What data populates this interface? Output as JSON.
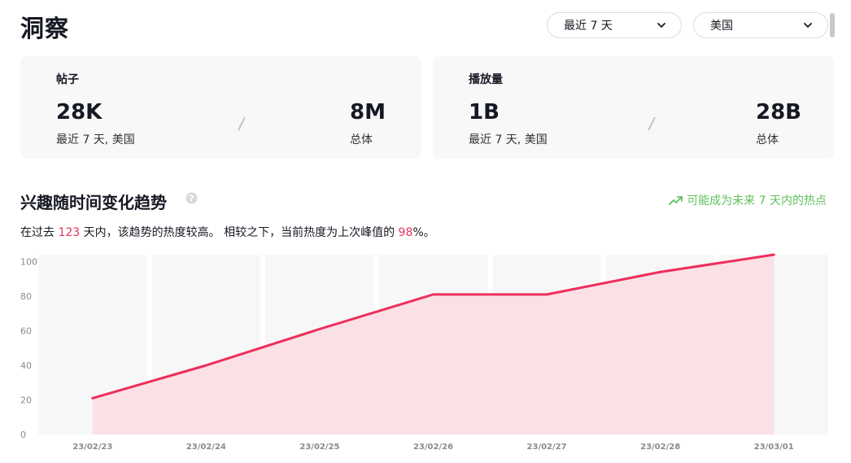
{
  "header": {
    "title": "洞察"
  },
  "filters": {
    "period": {
      "selected": "最近 7 天"
    },
    "region": {
      "selected": "美国"
    }
  },
  "cards": [
    {
      "title": "帖子",
      "recent_value": "28K",
      "recent_label": "最近 7 天, 美国",
      "total_value": "8M",
      "total_label": "总体"
    },
    {
      "title": "播放量",
      "recent_value": "1B",
      "recent_label": "最近 7 天, 美国",
      "total_value": "28B",
      "total_label": "总体"
    }
  ],
  "trend": {
    "title": "兴趣随时间变化趋势",
    "hint": "可能成为未来 7 天内的热点",
    "desc_prefix": "在过去 ",
    "days": "123",
    "desc_middle": " 天内，该趋势的热度较高。 相较之下，当前热度为上次峰值的 ",
    "peak_percent": "98",
    "desc_suffix": "%。"
  },
  "colors": {
    "accent": "#ee2e5c",
    "area_fill": "#fbe1e6",
    "hint_green": "#5fbf5b",
    "band": "#f7f7f7"
  },
  "chart_data": {
    "type": "area",
    "x": [
      "23/02/23",
      "23/02/24",
      "23/02/25",
      "23/02/26",
      "23/02/27",
      "23/02/28",
      "23/03/01"
    ],
    "series": [
      {
        "values": [
          21,
          40,
          61,
          81,
          81,
          94,
          104
        ]
      }
    ],
    "ylim": [
      0,
      104
    ],
    "yticks": [
      0,
      20,
      40,
      60,
      80,
      100
    ],
    "grid": false
  }
}
